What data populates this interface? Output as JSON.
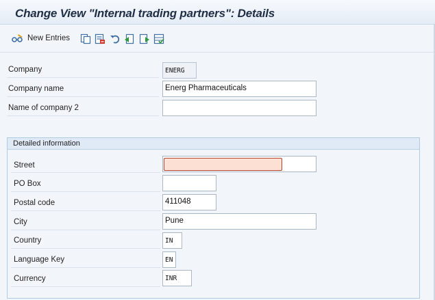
{
  "window": {
    "title": "Change View \"Internal trading partners\": Details"
  },
  "toolbar": {
    "new_entries_label": "New Entries",
    "icons": [
      "edit-glasses-icon",
      "copy-icon",
      "delete-icon",
      "undo-icon",
      "previous-entry-icon",
      "next-entry-icon",
      "select-all-icon"
    ]
  },
  "header_fields": {
    "company": {
      "label": "Company",
      "value": "ENERG"
    },
    "company_name": {
      "label": "Company name",
      "value": "Energ Pharmaceuticals"
    },
    "company_name2": {
      "label": "Name of company 2",
      "value": ""
    }
  },
  "detailed_info": {
    "title": "Detailed information",
    "street": {
      "label": "Street",
      "value": ""
    },
    "po_box": {
      "label": "PO Box",
      "value": ""
    },
    "postal_code": {
      "label": "Postal code",
      "value": "411048"
    },
    "city": {
      "label": "City",
      "value": "Pune"
    },
    "country": {
      "label": "Country",
      "value": "IN"
    },
    "language": {
      "label": "Language Key",
      "value": "EN"
    },
    "currency": {
      "label": "Currency",
      "value": "INR"
    }
  },
  "colors": {
    "error_field_bg": "#fce0d3",
    "error_field_border": "#b3432c",
    "group_header_bg": "#dfeaf6",
    "title_text": "#1f2e45"
  }
}
